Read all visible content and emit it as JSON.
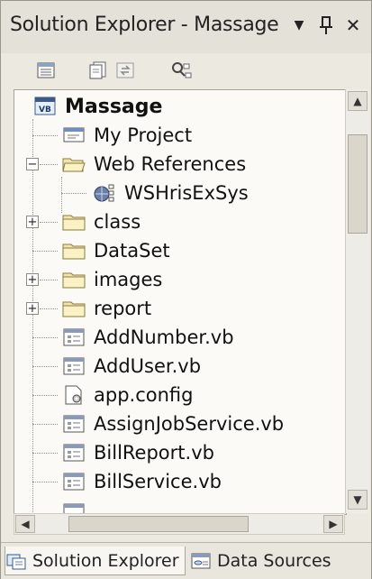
{
  "window": {
    "title": "Solution Explorer - Massage",
    "dropdown_glyph": "▼",
    "pin_glyph": "⊥",
    "close_glyph": "✕"
  },
  "toolbar": {
    "buttons": [
      "properties-icon",
      "show-all-files-icon",
      "refresh-icon",
      "class-view-icon"
    ]
  },
  "tree": {
    "root": {
      "label": "Massage",
      "icon": "vb-project-icon"
    },
    "items": [
      {
        "label": "My Project",
        "icon": "my-project-icon",
        "expander": ""
      },
      {
        "label": "Web References",
        "icon": "folder-open-icon",
        "expander": "−"
      },
      {
        "label": "WSHrisExSys",
        "icon": "web-reference-icon",
        "expander": ""
      },
      {
        "label": "class",
        "icon": "folder-icon",
        "expander": "+"
      },
      {
        "label": "DataSet",
        "icon": "folder-icon",
        "expander": ""
      },
      {
        "label": "images",
        "icon": "folder-icon",
        "expander": "+"
      },
      {
        "label": "report",
        "icon": "folder-icon",
        "expander": "+"
      },
      {
        "label": "AddNumber.vb",
        "icon": "vb-form-icon",
        "expander": ""
      },
      {
        "label": "AddUser.vb",
        "icon": "vb-form-icon",
        "expander": ""
      },
      {
        "label": "app.config",
        "icon": "config-file-icon",
        "expander": ""
      },
      {
        "label": "AssignJobService.vb",
        "icon": "vb-form-icon",
        "expander": ""
      },
      {
        "label": "BillReport.vb",
        "icon": "vb-form-icon",
        "expander": ""
      },
      {
        "label": "BillService.vb",
        "icon": "vb-form-icon",
        "expander": ""
      }
    ]
  },
  "scrollbar": {
    "up": "▲",
    "down": "▼",
    "left": "◀",
    "right": "▶"
  },
  "tabs": [
    {
      "label": "Solution Explorer",
      "active": true
    },
    {
      "label": "Data Sources",
      "active": false
    }
  ]
}
